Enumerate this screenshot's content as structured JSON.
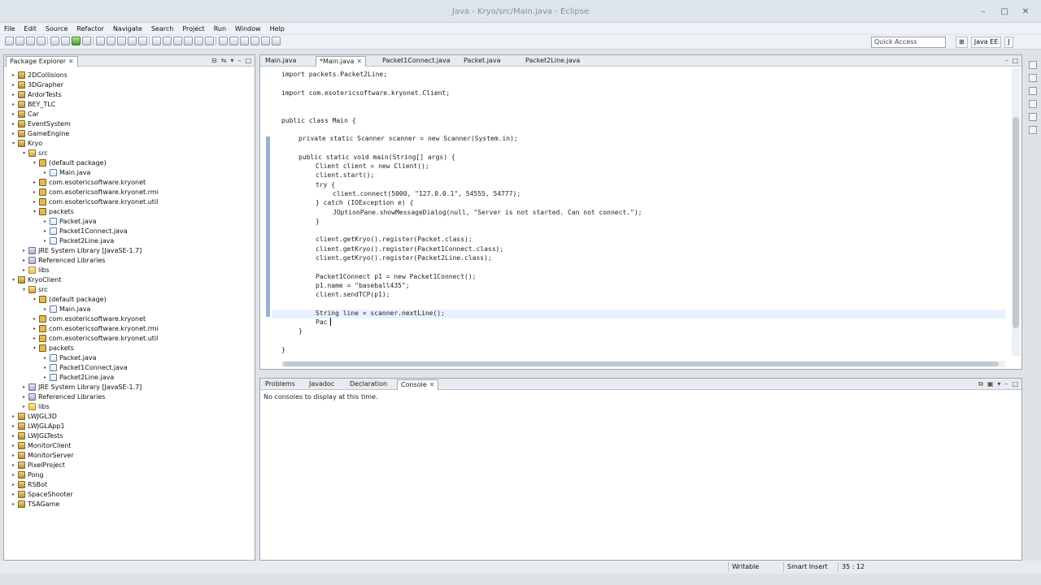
{
  "window": {
    "title": "Java - Kryo/src/Main.java - Eclipse",
    "controls": [
      "–",
      "□",
      "✕"
    ]
  },
  "menu": [
    "File",
    "Edit",
    "Source",
    "Refactor",
    "Navigate",
    "Search",
    "Project",
    "Run",
    "Window",
    "Help"
  ],
  "toolbar": {
    "quick_access": "Quick Access",
    "perspective": "Java EE"
  },
  "explorer": {
    "title": "Package Explorer",
    "items": [
      {
        "label": "2DCollisions",
        "depth": 0,
        "arrow": "▸",
        "icon": "proj"
      },
      {
        "label": "3DGrapher",
        "depth": 0,
        "arrow": "▸",
        "icon": "proj"
      },
      {
        "label": "ArdorTests",
        "depth": 0,
        "arrow": "▸",
        "icon": "proj"
      },
      {
        "label": "BEY_TLC",
        "depth": 0,
        "arrow": "▸",
        "icon": "proj"
      },
      {
        "label": "Car",
        "depth": 0,
        "arrow": "▸",
        "icon": "proj"
      },
      {
        "label": "EventSystem",
        "depth": 0,
        "arrow": "▸",
        "icon": "proj"
      },
      {
        "label": "GameEngine",
        "depth": 0,
        "arrow": "▸",
        "icon": "proj"
      },
      {
        "label": "Kryo",
        "depth": 0,
        "arrow": "▾",
        "icon": "proj"
      },
      {
        "label": "src",
        "depth": 1,
        "arrow": "▾",
        "icon": "src"
      },
      {
        "label": "(default package)",
        "depth": 2,
        "arrow": "▾",
        "icon": "pkg"
      },
      {
        "label": "Main.java",
        "depth": 3,
        "arrow": "▸",
        "icon": "java"
      },
      {
        "label": "com.esotericsoftware.kryonet",
        "depth": 2,
        "arrow": "▸",
        "icon": "pkg"
      },
      {
        "label": "com.esotericsoftware.kryonet.rmi",
        "depth": 2,
        "arrow": "▸",
        "icon": "pkg"
      },
      {
        "label": "com.esotericsoftware.kryonet.util",
        "depth": 2,
        "arrow": "▸",
        "icon": "pkg"
      },
      {
        "label": "packets",
        "depth": 2,
        "arrow": "▾",
        "icon": "pkg"
      },
      {
        "label": "Packet.java",
        "depth": 3,
        "arrow": "▸",
        "icon": "java"
      },
      {
        "label": "Packet1Connect.java",
        "depth": 3,
        "arrow": "▸",
        "icon": "java"
      },
      {
        "label": "Packet2Line.java",
        "depth": 3,
        "arrow": "▸",
        "icon": "java"
      },
      {
        "label": "JRE System Library [JavaSE-1.7]",
        "depth": 1,
        "arrow": "▸",
        "icon": "lib"
      },
      {
        "label": "Referenced Libraries",
        "depth": 1,
        "arrow": "▸",
        "icon": "lib"
      },
      {
        "label": "libs",
        "depth": 1,
        "arrow": "▸",
        "icon": "folder"
      },
      {
        "label": "KryoClient",
        "depth": 0,
        "arrow": "▾",
        "icon": "proj"
      },
      {
        "label": "src",
        "depth": 1,
        "arrow": "▾",
        "icon": "src"
      },
      {
        "label": "(default package)",
        "depth": 2,
        "arrow": "▾",
        "icon": "pkg"
      },
      {
        "label": "Main.java",
        "depth": 3,
        "arrow": "▸",
        "icon": "java"
      },
      {
        "label": "com.esotericsoftware.kryonet",
        "depth": 2,
        "arrow": "▸",
        "icon": "pkg"
      },
      {
        "label": "com.esotericsoftware.kryonet.rmi",
        "depth": 2,
        "arrow": "▸",
        "icon": "pkg"
      },
      {
        "label": "com.esotericsoftware.kryonet.util",
        "depth": 2,
        "arrow": "▸",
        "icon": "pkg"
      },
      {
        "label": "packets",
        "depth": 2,
        "arrow": "▾",
        "icon": "pkg"
      },
      {
        "label": "Packet.java",
        "depth": 3,
        "arrow": "▸",
        "icon": "java"
      },
      {
        "label": "Packet1Connect.java",
        "depth": 3,
        "arrow": "▸",
        "icon": "java"
      },
      {
        "label": "Packet2Line.java",
        "depth": 3,
        "arrow": "▸",
        "icon": "java"
      },
      {
        "label": "JRE System Library [JavaSE-1.7]",
        "depth": 1,
        "arrow": "▸",
        "icon": "lib"
      },
      {
        "label": "Referenced Libraries",
        "depth": 1,
        "arrow": "▸",
        "icon": "lib"
      },
      {
        "label": "libs",
        "depth": 1,
        "arrow": "▸",
        "icon": "folder"
      },
      {
        "label": "LWJGL3D",
        "depth": 0,
        "arrow": "▸",
        "icon": "proj"
      },
      {
        "label": "LWJGLApp1",
        "depth": 0,
        "arrow": "▸",
        "icon": "proj"
      },
      {
        "label": "LWJGLTests",
        "depth": 0,
        "arrow": "▸",
        "icon": "proj"
      },
      {
        "label": "MonitorClient",
        "depth": 0,
        "arrow": "▸",
        "icon": "proj"
      },
      {
        "label": "MonitorServer",
        "depth": 0,
        "arrow": "▸",
        "icon": "proj"
      },
      {
        "label": "PixelProject",
        "depth": 0,
        "arrow": "▸",
        "icon": "proj"
      },
      {
        "label": "Pong",
        "depth": 0,
        "arrow": "▸",
        "icon": "proj"
      },
      {
        "label": "RSBot",
        "depth": 0,
        "arrow": "▸",
        "icon": "proj"
      },
      {
        "label": "SpaceShooter",
        "depth": 0,
        "arrow": "▸",
        "icon": "proj"
      },
      {
        "label": "TSAGame",
        "depth": 0,
        "arrow": "▸",
        "icon": "proj"
      }
    ]
  },
  "editor": {
    "tabs": [
      {
        "label": "Main.java",
        "active": false
      },
      {
        "label": "*Main.java",
        "active": true
      },
      {
        "label": "Packet1Connect.java",
        "active": false
      },
      {
        "label": "Packet.java",
        "active": false
      },
      {
        "label": "Packet2Line.java",
        "active": false
      }
    ],
    "lines": [
      {
        "t": "import packets.Packet2Line;",
        "i": 0
      },
      {
        "t": "",
        "i": 0
      },
      {
        "t": "import com.esotericsoftware.kryonet.Client;",
        "i": 0
      },
      {
        "t": "",
        "i": 0
      },
      {
        "t": "",
        "i": 0
      },
      {
        "t": "public class Main {",
        "i": 0
      },
      {
        "t": "",
        "i": 0
      },
      {
        "t": "private static Scanner scanner = new Scanner(System.in);",
        "i": 1
      },
      {
        "t": "",
        "i": 0
      },
      {
        "t": "public static void main(String[] args) {",
        "i": 1
      },
      {
        "t": "Client client = new Client();",
        "i": 2
      },
      {
        "t": "client.start();",
        "i": 2
      },
      {
        "t": "try {",
        "i": 2
      },
      {
        "t": "client.connect(5000, \"127.0.0.1\", 54555, 54777);",
        "i": 3
      },
      {
        "t": "} catch (IOException e) {",
        "i": 2
      },
      {
        "t": "JOptionPane.showMessageDialog(null, \"Server is not started. Can not connect.\");",
        "i": 3
      },
      {
        "t": "}",
        "i": 2
      },
      {
        "t": "",
        "i": 0
      },
      {
        "t": "client.getKryo().register(Packet.class);",
        "i": 2
      },
      {
        "t": "client.getKryo().register(Packet1Connect.class);",
        "i": 2
      },
      {
        "t": "client.getKryo().register(Packet2Line.class);",
        "i": 2
      },
      {
        "t": "",
        "i": 0
      },
      {
        "t": "Packet1Connect p1 = new Packet1Connect();",
        "i": 2
      },
      {
        "t": "p1.name = \"baseball435\";",
        "i": 2
      },
      {
        "t": "client.sendTCP(p1);",
        "i": 2
      },
      {
        "t": "",
        "i": 0
      },
      {
        "t": "String line = scanner.nextLine();",
        "i": 2
      },
      {
        "t": "Pac",
        "i": 2
      },
      {
        "t": "}",
        "i": 1
      },
      {
        "t": "",
        "i": 0
      },
      {
        "t": "}",
        "i": 0
      }
    ]
  },
  "console": {
    "tabs": [
      {
        "label": "Problems",
        "active": false
      },
      {
        "label": "Javadoc",
        "active": false
      },
      {
        "label": "Declaration",
        "active": false
      },
      {
        "label": "Console",
        "active": true
      }
    ],
    "message": "No consoles to display at this time."
  },
  "status": {
    "mode": "Writable",
    "insert": "Smart Insert",
    "position": "35 : 12"
  }
}
